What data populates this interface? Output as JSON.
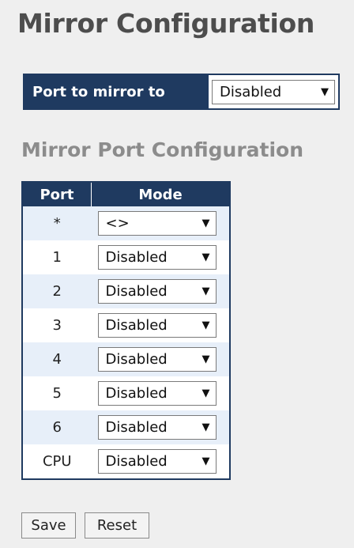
{
  "page_title": "Mirror Configuration",
  "mirror_to": {
    "label": "Port to mirror to",
    "value": "Disabled"
  },
  "section_title": "Mirror Port Configuration",
  "table": {
    "headers": [
      "Port",
      "Mode"
    ],
    "rows": [
      {
        "port": "*",
        "mode": "<>"
      },
      {
        "port": "1",
        "mode": "Disabled"
      },
      {
        "port": "2",
        "mode": "Disabled"
      },
      {
        "port": "3",
        "mode": "Disabled"
      },
      {
        "port": "4",
        "mode": "Disabled"
      },
      {
        "port": "5",
        "mode": "Disabled"
      },
      {
        "port": "6",
        "mode": "Disabled"
      },
      {
        "port": "CPU",
        "mode": "Disabled"
      }
    ]
  },
  "buttons": {
    "save": "Save",
    "reset": "Reset"
  },
  "icons": {
    "dropdown": "chevron-down-icon"
  },
  "colors": {
    "header_bg": "#1f3a60",
    "row_alt_bg": "#e7eff9",
    "page_bg": "#efefef"
  }
}
